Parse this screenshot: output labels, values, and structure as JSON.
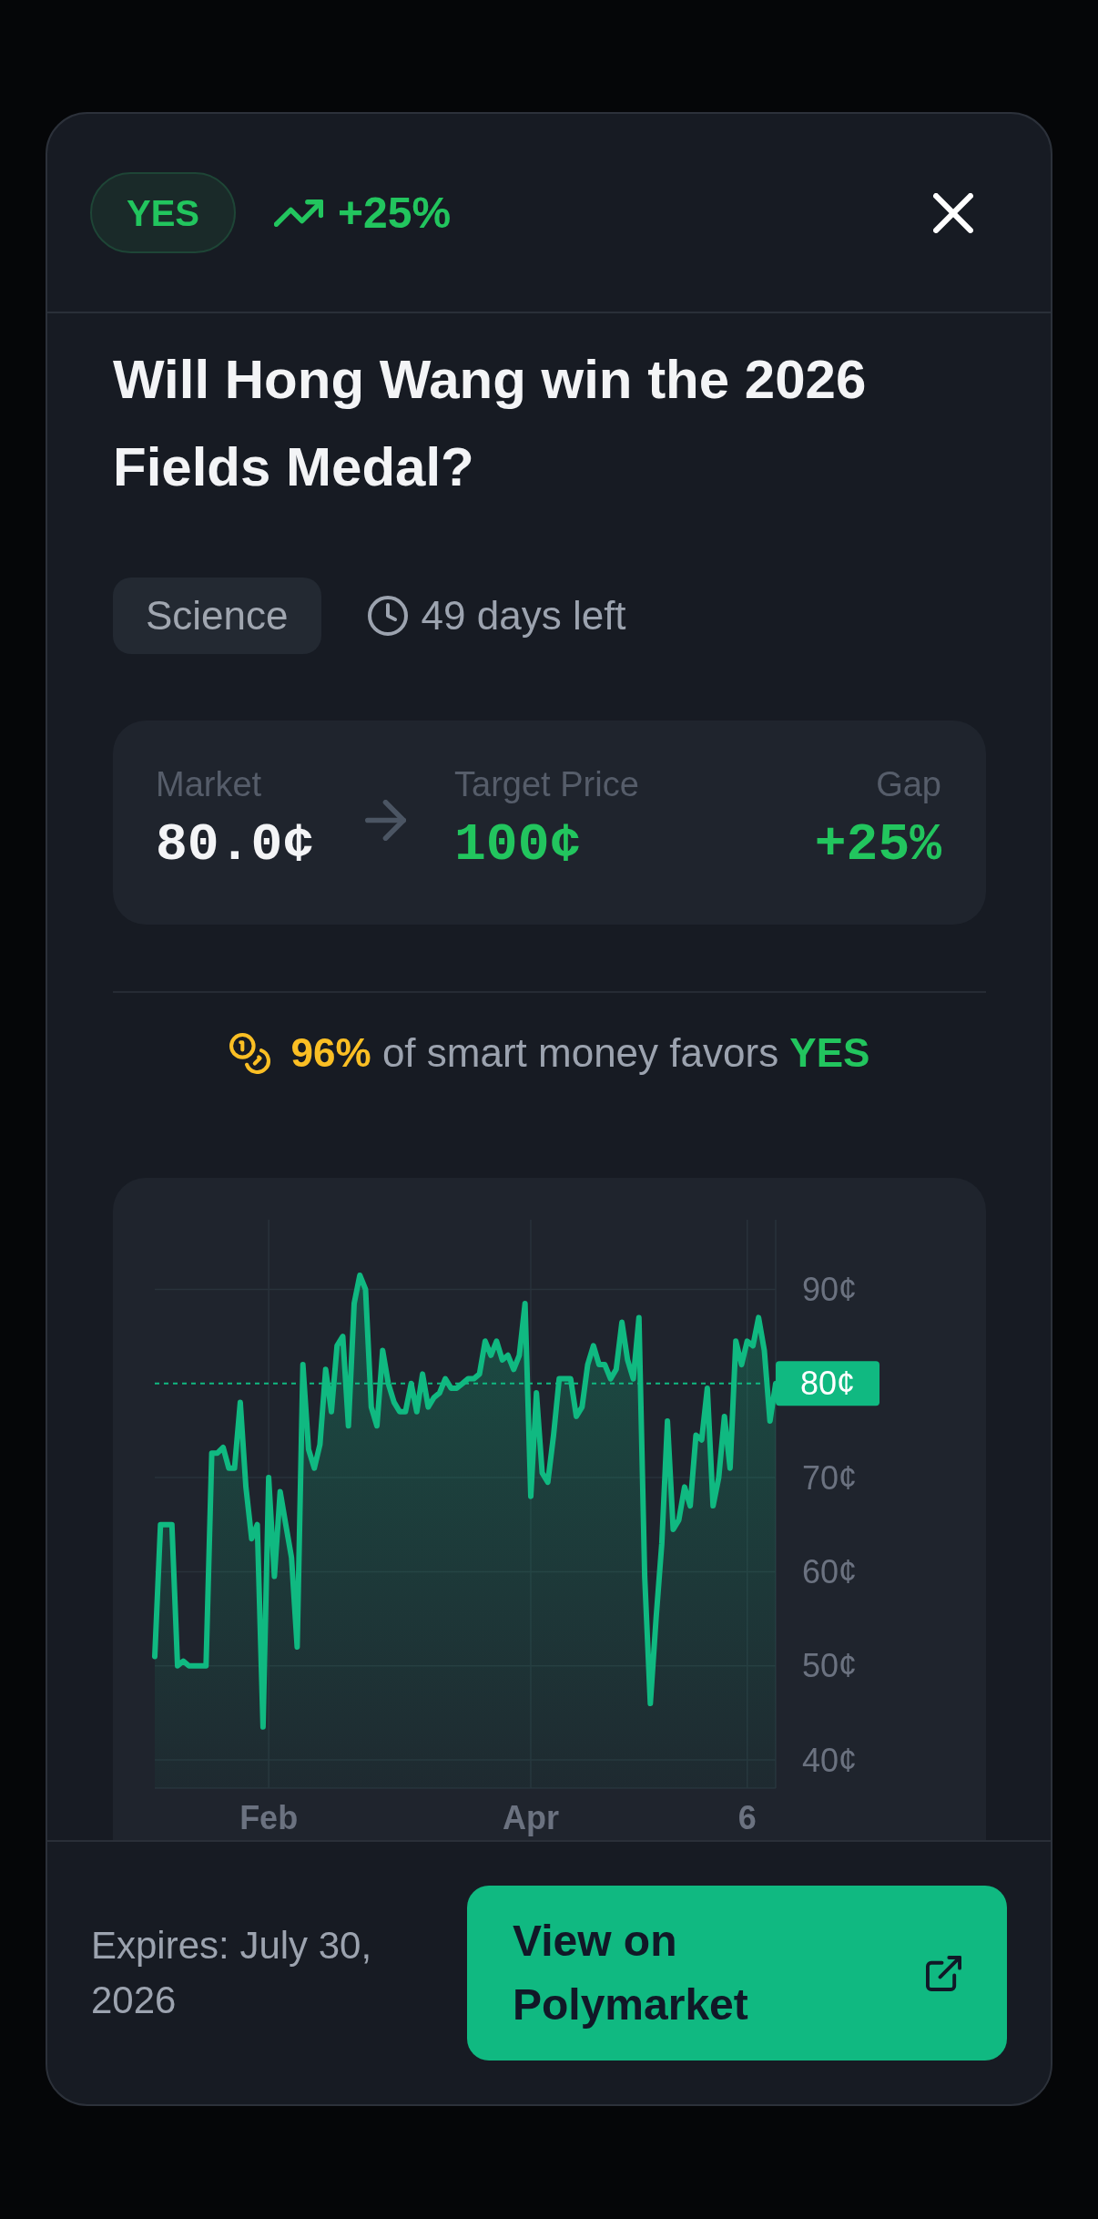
{
  "header": {
    "outcome": {
      "label": "YES",
      "positive": true
    },
    "change": {
      "text": "+25%",
      "rising": true
    }
  },
  "title": "Will Hong Wang win the 2026 Fields Medal?",
  "category": "Science",
  "time_left": "49 days left",
  "stats": [
    {
      "label": "Market",
      "value": "80.0¢",
      "color": "#f3f4f6"
    },
    {
      "label": "Target Price",
      "value": "100¢",
      "color": "#22c55e"
    },
    {
      "label": "Gap",
      "value": "+25%",
      "color": "#22c55e"
    }
  ],
  "smart_money": {
    "share": "96%",
    "text": "of smart money favors",
    "side": "YES"
  },
  "chart": {
    "chart_data": {
      "type": "area",
      "grid": true,
      "categories": [
        null,
        null,
        null,
        null,
        null,
        null,
        null,
        null,
        null,
        null,
        null,
        null,
        null,
        null,
        null,
        null,
        null,
        null,
        null,
        null,
        "Feb",
        null,
        null,
        null,
        null,
        null,
        null,
        null,
        null,
        null,
        null,
        null,
        null,
        null,
        null,
        null,
        null,
        null,
        null,
        null,
        null,
        null,
        null,
        null,
        null,
        null,
        null,
        null,
        null,
        null,
        null,
        null,
        null,
        null,
        null,
        null,
        null,
        null,
        null,
        null,
        null,
        null,
        null,
        null,
        null,
        null,
        "Apr",
        null,
        null,
        null,
        null,
        null,
        null,
        null,
        null,
        null,
        null,
        null,
        null,
        null,
        null,
        null,
        null,
        null,
        null,
        null,
        null,
        null,
        null,
        null,
        null,
        null,
        null,
        null,
        null,
        null,
        null,
        null,
        null,
        null,
        null,
        null,
        null,
        null,
        "6",
        null,
        null,
        null,
        null,
        null
      ],
      "ylim": [
        37,
        97.4
      ],
      "yticks": [
        {
          "value": 40,
          "label": "40¢"
        },
        {
          "value": 50,
          "label": "50¢"
        },
        {
          "value": 60,
          "label": "60¢"
        },
        {
          "value": 70,
          "label": "70¢"
        },
        {
          "value": 90,
          "label": "90¢"
        }
      ],
      "series": [
        {
          "color": "#10b981",
          "values": [
            51,
            65,
            65,
            65,
            50,
            50.5,
            50,
            50,
            50,
            50,
            72.6,
            72.6,
            73.2,
            71,
            71,
            78,
            69,
            63.5,
            65,
            43.5,
            70,
            59.5,
            68.5,
            65,
            61.5,
            52,
            82,
            73,
            71,
            73.5,
            81.5,
            77,
            84,
            85,
            75.5,
            88.5,
            91.5,
            90,
            77.5,
            75.5,
            83.5,
            80,
            78,
            77,
            77,
            80,
            77,
            81,
            77.5,
            78.5,
            79,
            80.5,
            79.5,
            79.5,
            80,
            80.5,
            80.5,
            81,
            84.5,
            83,
            84.5,
            82.5,
            83,
            81.5,
            83,
            88.5,
            68,
            79,
            70.5,
            69.5,
            74.5,
            80.5,
            80.5,
            80.5,
            76.5,
            77.5,
            82,
            84,
            82,
            82,
            80.5,
            81.5,
            86.5,
            82.5,
            80.5,
            87,
            59.5,
            46,
            55,
            63,
            76,
            64.5,
            65.5,
            69,
            67,
            74.5,
            74,
            79.5,
            67,
            70,
            76.5,
            71,
            84.5,
            82,
            84.5,
            84,
            87,
            83.5,
            76,
            80
          ]
        }
      ],
      "ref_lines": [
        {
          "axis": "y",
          "value": 80,
          "label": "80¢"
        }
      ]
    }
  },
  "footer": {
    "expires": "Expires: July 30, 2026",
    "button": "View on Polymarket"
  }
}
